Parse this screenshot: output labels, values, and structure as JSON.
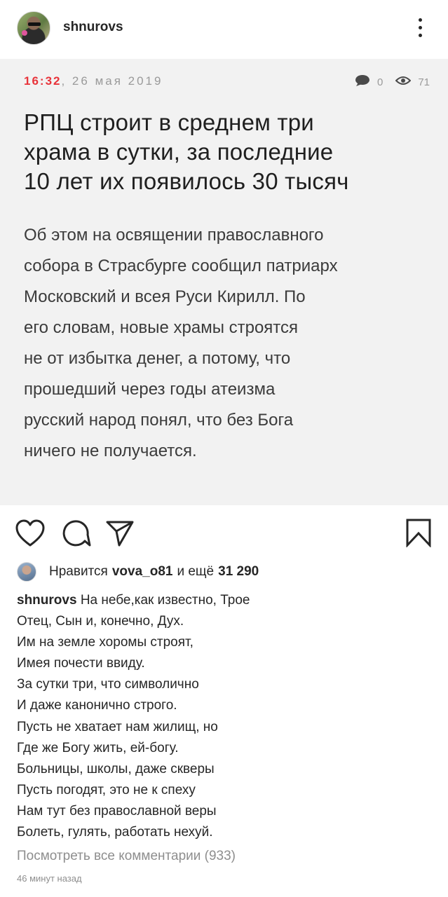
{
  "header": {
    "username": "shnurovs"
  },
  "post_image": {
    "time": "16:32",
    "date": ", 26 мая 2019",
    "comments_count": "0",
    "views_count": "71",
    "headline_lines": [
      "РПЦ строит в  среднем три",
      "храма в  сутки, за последние",
      "10 лет их появилось 30 тысяч"
    ],
    "lead_lines": [
      "Об  этом на  освящении православного",
      "собора в Страсбурге сообщил патриарх",
      "Московский и всея Руси Кирилл. По",
      "его словам, новые храмы строятся",
      "не от избытка денег, а потому, что",
      "прошедший через годы атеизма",
      "русский народ понял, что без Бога",
      "ничего не получается."
    ]
  },
  "likes": {
    "prefix": "Нравится",
    "user": "vova_o81",
    "middle": "и ещё",
    "count": "31 290"
  },
  "caption": {
    "username": "shnurovs",
    "lines": [
      "На небе,как известно, Трое",
      "Отец, Сын и, конечно, Дух.",
      "Им на земле хоромы строят,",
      "Имея почести ввиду.",
      "За сутки три, что символично",
      "И даже канонично строго.",
      "Пусть не хватает нам жилищ, но",
      "Где же Богу жить, ей-богу.",
      "Больницы, школы, даже скверы",
      "Пусть погодят, это не к спеху",
      "Нам тут без православной веры",
      "Болеть, гулять, работать нехуй."
    ]
  },
  "view_comments": "Посмотреть все комментарии (933)",
  "timestamp": "46 минут назад",
  "icons": {
    "more": "more-vertical-icon",
    "like": "heart-icon",
    "comment": "comment-icon",
    "share": "paper-plane-icon",
    "save": "bookmark-icon",
    "comments_stat": "speech-bubble-icon",
    "views_stat": "eye-icon"
  },
  "colors": {
    "time_accent": "#e8333a",
    "post_bg": "#f2f2f2",
    "muted_text": "#8e8e8e"
  }
}
